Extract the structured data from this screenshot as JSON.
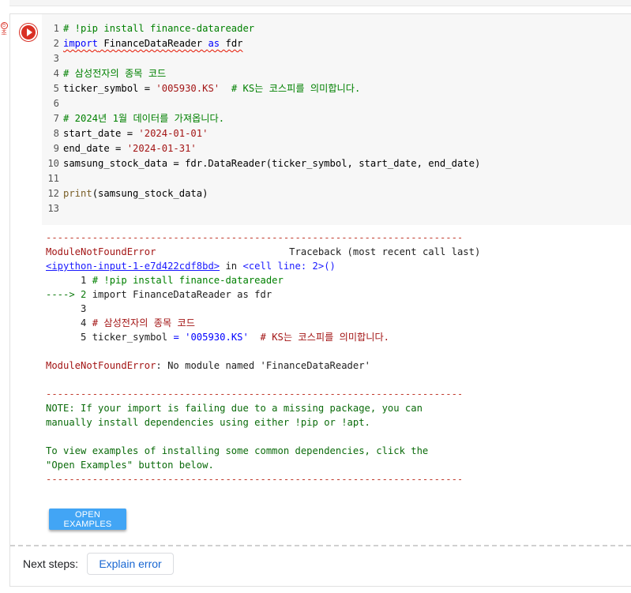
{
  "gutter": {
    "badge_icon": "clock-icon",
    "badge_label": "초"
  },
  "editor": {
    "lines": [
      {
        "n": "1",
        "parts": [
          {
            "t": "# !pip install finance-datareader",
            "c": "cmt"
          }
        ]
      },
      {
        "n": "2",
        "parts": [
          {
            "t": "import",
            "c": "kw squig"
          },
          {
            "t": " FinanceDataReader ",
            "c": "squig"
          },
          {
            "t": "as",
            "c": "kw squig"
          },
          {
            "t": " fdr",
            "c": "squig"
          }
        ]
      },
      {
        "n": "3",
        "parts": []
      },
      {
        "n": "4",
        "parts": [
          {
            "t": "# 삼성전자의 종목 코드",
            "c": "cmt"
          }
        ]
      },
      {
        "n": "5",
        "parts": [
          {
            "t": "ticker_symbol = ",
            "c": ""
          },
          {
            "t": "'005930.KS'",
            "c": "str"
          },
          {
            "t": "  ",
            "c": ""
          },
          {
            "t": "# KS는 코스피를 의미합니다.",
            "c": "cmt"
          }
        ]
      },
      {
        "n": "6",
        "parts": []
      },
      {
        "n": "7",
        "parts": [
          {
            "t": "# 2024년 1월 데이터를 가져옵니다.",
            "c": "cmt"
          }
        ]
      },
      {
        "n": "8",
        "parts": [
          {
            "t": "start_date = ",
            "c": ""
          },
          {
            "t": "'2024-01-01'",
            "c": "str"
          }
        ]
      },
      {
        "n": "9",
        "parts": [
          {
            "t": "end_date = ",
            "c": ""
          },
          {
            "t": "'2024-01-31'",
            "c": "str"
          }
        ]
      },
      {
        "n": "10",
        "parts": [
          {
            "t": "samsung_stock_data = fdr.DataReader(ticker_symbol, start_date, end_date)",
            "c": ""
          }
        ]
      },
      {
        "n": "11",
        "parts": []
      },
      {
        "n": "12",
        "parts": [
          {
            "t": "print",
            "c": "fn"
          },
          {
            "t": "(samsung_stock_data)",
            "c": ""
          }
        ]
      },
      {
        "n": "13",
        "parts": []
      }
    ]
  },
  "output": {
    "lines": [
      [
        {
          "t": "---------------------------------------------------------------------------",
          "c": "dash"
        }
      ],
      [
        {
          "t": "ModuleNotFoundError",
          "c": "errname"
        },
        {
          "t": "                       Traceback (most recent call last)",
          "c": ""
        }
      ],
      [
        {
          "t": "<ipython-input-1-e7d422cdf8bd>",
          "c": "tblink"
        },
        {
          "t": " in ",
          "c": ""
        },
        {
          "t": "<cell line: 2>()",
          "c": "celllink"
        }
      ],
      [
        {
          "t": "      1 ",
          "c": ""
        },
        {
          "t": "# !pip install finance-datareader",
          "c": "cmt"
        }
      ],
      [
        {
          "t": "----> 2 ",
          "c": "arrow"
        },
        {
          "t": "import FinanceDataReader as fdr",
          "c": ""
        }
      ],
      [
        {
          "t": "      3",
          "c": ""
        }
      ],
      [
        {
          "t": "      4 ",
          "c": ""
        },
        {
          "t": "# 삼성전자의 종목 코드",
          "c": "errname"
        }
      ],
      [
        {
          "t": "      5 ",
          "c": ""
        },
        {
          "t": "ticker_symbol ",
          "c": ""
        },
        {
          "t": "= ",
          "c": "kw"
        },
        {
          "t": "'005930.KS'",
          "c": "kw"
        },
        {
          "t": "  ",
          "c": ""
        },
        {
          "t": "# KS는 코스피를 의미합니다.",
          "c": "errname"
        }
      ],
      [],
      [
        {
          "t": "ModuleNotFoundError",
          "c": "errname"
        },
        {
          "t": ": No module named 'FinanceDataReader'",
          "c": ""
        }
      ],
      [],
      [
        {
          "t": "---------------------------------------------------------------------------|",
          "c": "dash"
        }
      ],
      [
        {
          "t": "NOTE: If your import is failing due to a missing package, you can",
          "c": "note"
        }
      ],
      [
        {
          "t": "manually install dependencies using either !pip or !apt.",
          "c": "note"
        }
      ],
      [],
      [
        {
          "t": "To view examples of installing some common dependencies, click the",
          "c": "note"
        }
      ],
      [
        {
          "t": "\"Open Examples\" button below.",
          "c": "note"
        }
      ],
      [
        {
          "t": "---------------------------------------------------------------------------",
          "c": "dash"
        }
      ]
    ]
  },
  "open_examples_label": "OPEN EXAMPLES",
  "next_steps": {
    "label": "Next steps:",
    "button": "Explain error"
  }
}
